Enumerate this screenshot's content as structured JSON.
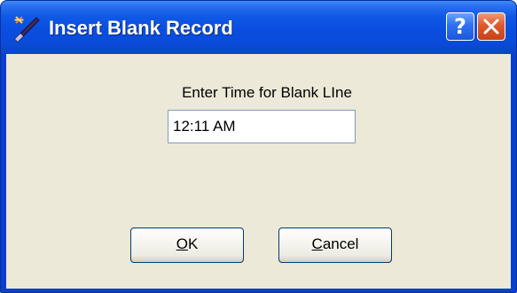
{
  "window": {
    "title": "Insert Blank Record",
    "app_icon": "wand-icon",
    "help_button": {
      "icon": "question-icon",
      "label": "?"
    },
    "close_button": {
      "icon": "close-icon"
    }
  },
  "dialog": {
    "prompt": "Enter Time for Blank LIne",
    "time_value": "12:11 AM"
  },
  "buttons": {
    "ok": {
      "mnemonic": "O",
      "rest": "K"
    },
    "cancel": {
      "mnemonic": "C",
      "rest": "ancel"
    }
  },
  "colors": {
    "titlebar": "#0a4ee0",
    "client_bg": "#ece9d8",
    "close_red": "#df5a2c",
    "help_blue": "#2f70f0"
  }
}
